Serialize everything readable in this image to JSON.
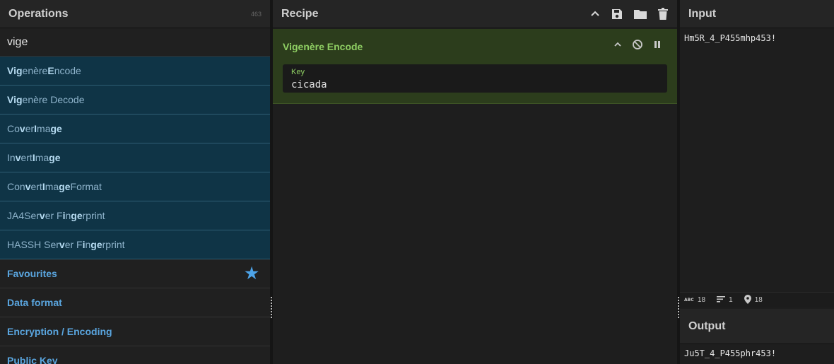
{
  "operations": {
    "title": "Operations",
    "count": "463",
    "search_value": "vige",
    "results": [
      {
        "parts": [
          [
            "b",
            "Vig"
          ],
          [
            "n",
            "enère "
          ],
          [
            "b",
            "E"
          ],
          [
            "n",
            "ncode"
          ]
        ]
      },
      {
        "parts": [
          [
            "b",
            "Vig"
          ],
          [
            "n",
            "enère Decode"
          ]
        ]
      },
      {
        "parts": [
          [
            "n",
            "Co"
          ],
          [
            "b",
            "v"
          ],
          [
            "n",
            "er "
          ],
          [
            "b",
            "I"
          ],
          [
            "n",
            "ma"
          ],
          [
            "b",
            "ge"
          ]
        ]
      },
      {
        "parts": [
          [
            "n",
            "In"
          ],
          [
            "b",
            "v"
          ],
          [
            "n",
            "ert "
          ],
          [
            "b",
            "I"
          ],
          [
            "n",
            "ma"
          ],
          [
            "b",
            "ge"
          ]
        ]
      },
      {
        "parts": [
          [
            "n",
            "Con"
          ],
          [
            "b",
            "v"
          ],
          [
            "n",
            "ert "
          ],
          [
            "b",
            "I"
          ],
          [
            "n",
            "ma"
          ],
          [
            "b",
            "ge"
          ],
          [
            "n",
            " Format"
          ]
        ]
      },
      {
        "parts": [
          [
            "n",
            "JA4Ser"
          ],
          [
            "b",
            "v"
          ],
          [
            "n",
            "er F"
          ],
          [
            "b",
            "i"
          ],
          [
            "n",
            "n"
          ],
          [
            "b",
            "ge"
          ],
          [
            "n",
            "rprint"
          ]
        ]
      },
      {
        "parts": [
          [
            "n",
            "HASSH Ser"
          ],
          [
            "b",
            "v"
          ],
          [
            "n",
            "er F"
          ],
          [
            "b",
            "i"
          ],
          [
            "n",
            "n"
          ],
          [
            "b",
            "ge"
          ],
          [
            "n",
            "rprint"
          ]
        ]
      }
    ],
    "categories": [
      "Favourites",
      "Data format",
      "Encryption / Encoding",
      "Public Key"
    ]
  },
  "recipe": {
    "title": "Recipe",
    "operation": {
      "name": "Vigenère Encode",
      "arg_label": "Key",
      "arg_value": "cicada"
    }
  },
  "input": {
    "title": "Input",
    "text": "Hm5R_4_P455mhp453!",
    "stats": {
      "length": "18",
      "lines": "1",
      "position": "18"
    }
  },
  "output": {
    "title": "Output",
    "text": "Ju5T_4_P455phr453!"
  },
  "colors": {
    "accent": "#5aa6e0",
    "op_green": "#8fcf63",
    "result_bg": "#0f3446"
  }
}
